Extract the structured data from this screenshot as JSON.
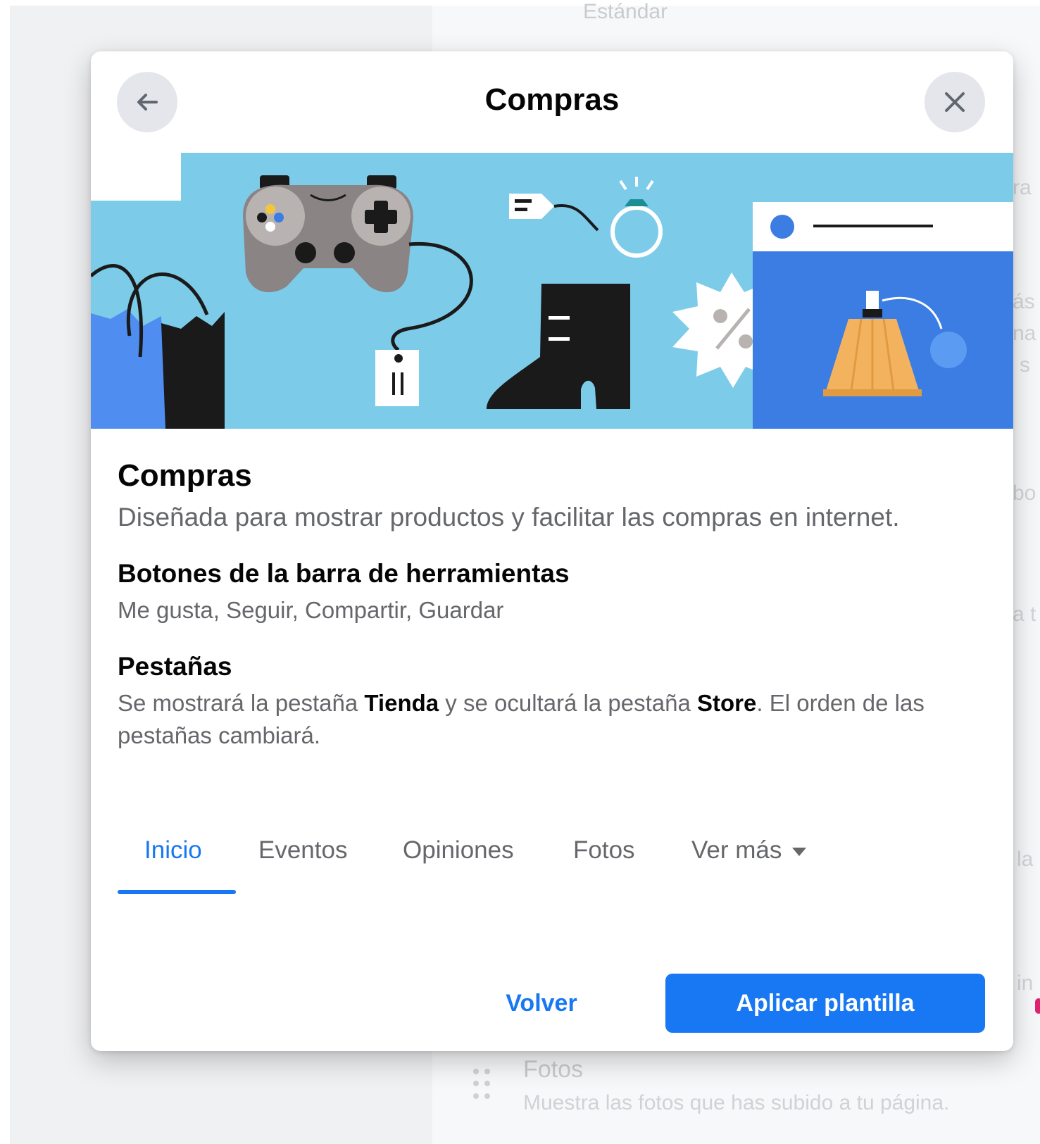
{
  "background": {
    "top_label": "Estándar",
    "right_fragments": [
      "ra",
      "ás",
      "na",
      "s",
      "bo",
      "a t",
      "la",
      "in"
    ],
    "list_item_title": "Fotos",
    "list_item_description": "Muestra las fotos que has subido a tu página."
  },
  "modal": {
    "title": "Compras",
    "back_icon": "arrow-left-icon",
    "close_icon": "close-icon"
  },
  "template": {
    "name": "Compras",
    "description": "Diseñada para mostrar productos y facilitar las compras en internet.",
    "toolbar_section": {
      "title": "Botones de la barra de herramientas",
      "text": "Me gusta, Seguir, Compartir, Guardar"
    },
    "tabs_section": {
      "title": "Pestañas",
      "text_part1": "Se mostrará la pestaña ",
      "bold1": "Tienda",
      "text_part2": " y se ocultará la pestaña ",
      "bold2": "Store",
      "text_part3": ". El orden de las pestañas cambiará."
    }
  },
  "preview_tabs": [
    {
      "label": "Inicio",
      "active": true
    },
    {
      "label": "Eventos",
      "active": false
    },
    {
      "label": "Opiniones",
      "active": false
    },
    {
      "label": "Fotos",
      "active": false
    },
    {
      "label": "Ver más",
      "active": false
    }
  ],
  "footer": {
    "secondary_label": "Volver",
    "primary_label": "Aplicar plantilla"
  },
  "colors": {
    "accent": "#1877f2",
    "banner_sky": "#7ccbe9",
    "banner_blue": "#3b7de3"
  }
}
